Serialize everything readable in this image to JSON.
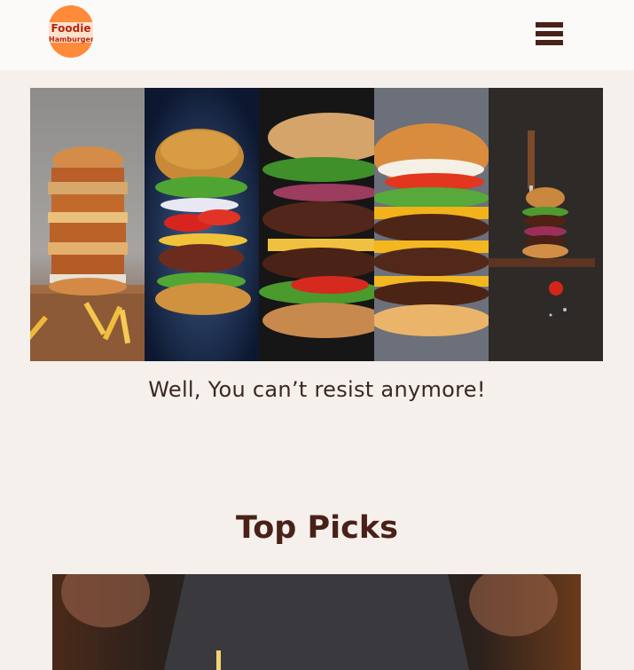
{
  "header": {
    "logo_line1": "Foodie",
    "logo_line2": "Hamburger",
    "menu_icon": "hamburger-menu-icon"
  },
  "hero": {
    "panel_count": 5,
    "tagline": "Well, You can’t resist anymore!"
  },
  "top_picks": {
    "title": "Top Picks"
  },
  "colors": {
    "background": "#f5f0ec",
    "header_bg": "#fcfaf9",
    "brand_orange": "#ff8a3a",
    "brand_red": "#b8230f",
    "dark_brown": "#4a2118"
  }
}
